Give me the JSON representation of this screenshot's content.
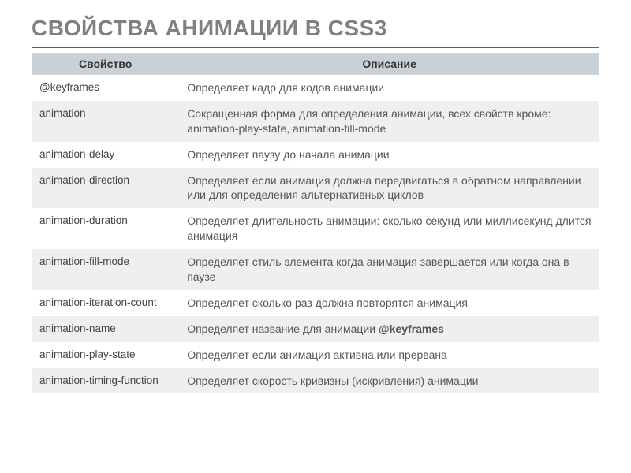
{
  "title": "СВОЙСТВА АНИМАЦИИ В CSS3",
  "headers": {
    "property": "Свойство",
    "description": "Описание"
  },
  "rows": [
    {
      "property": "@keyframes",
      "description": "Определяет кадр для кодов анимации"
    },
    {
      "property": "animation",
      "description": "Сокращенная форма для определения анимации, всех свойств кроме:  animation-play-state,  animation-fill-mode"
    },
    {
      "property": "animation-delay",
      "description": "Определяет паузу до начала анимации"
    },
    {
      "property": "animation-direction",
      "description": "Определяет если анимация должна передвигаться в обратном направлении или для определения альтернативных циклов"
    },
    {
      "property": "animation-duration",
      "description": "Определяет длительность анимации: сколько секунд или миллисекунд длится анимация"
    },
    {
      "property": "animation-fill-mode",
      "description": "Определяет стиль элемента когда анимация завершается  или когда она в паузе"
    },
    {
      "property": "animation-iteration-count",
      "description": "Определяет сколько раз должна повторятся анимация"
    },
    {
      "property": "animation-name",
      "description_prefix": "Определяет название для анимации ",
      "description_bold": "@keyframes"
    },
    {
      "property": "animation-play-state",
      "description": "Определяет если анимация активна или прервана"
    },
    {
      "property": "animation-timing-function",
      "description": "Определяет скорость кривизны (искривления) анимации"
    }
  ]
}
